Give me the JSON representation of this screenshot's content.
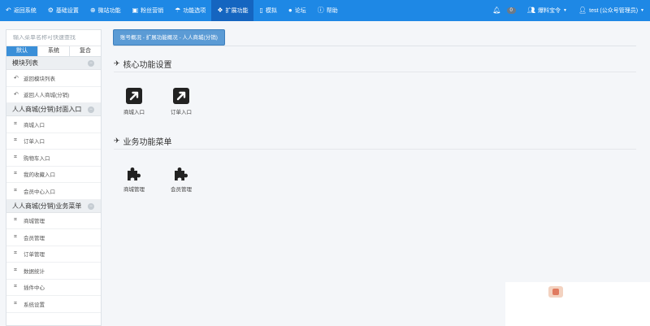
{
  "topnav": {
    "items": [
      {
        "label": "返回系统",
        "icon": "reply-icon"
      },
      {
        "label": "基础设置",
        "icon": "gear-icon"
      },
      {
        "label": "微站功能",
        "icon": "plus-circle-icon"
      },
      {
        "label": "粉丝营销",
        "icon": "gift-icon"
      },
      {
        "label": "功能选项",
        "icon": "umbrella-icon"
      },
      {
        "label": "扩展功能",
        "icon": "cubes-icon",
        "active": true
      },
      {
        "label": "模拟",
        "icon": "mobile-icon"
      },
      {
        "label": "论坛",
        "icon": "comment-icon"
      },
      {
        "label": "帮助",
        "icon": "info-circle-icon"
      }
    ],
    "notification_count": "0",
    "account_label": "爆料宝令",
    "user_label": "test (公众号管理员)"
  },
  "sidebar": {
    "search_placeholder": "输入菜单名称可快速查找",
    "tabs": [
      "默认",
      "系统",
      "复合"
    ],
    "groups": [
      {
        "title": "模块列表",
        "items": [
          "返回模块列表",
          "返回人人商城(分销)"
        ]
      },
      {
        "title": "人人商城(分销)封面入口",
        "items": [
          "商城入口",
          "订单入口",
          "购物车入口",
          "我的收藏入口",
          "会员中心入口"
        ]
      },
      {
        "title": "人人商城(分销)业务菜单",
        "items": [
          "商城管理",
          "会员管理",
          "订单管理",
          "数据统计",
          "插件中心",
          "系统设置"
        ]
      }
    ]
  },
  "main": {
    "breadcrumb": "账号概况 - 扩展功能概况 - 人人商城(分销)",
    "sections": [
      {
        "title": "核心功能设置",
        "tiles": [
          "商城入口",
          "订单入口"
        ]
      },
      {
        "title": "业务功能菜单",
        "tiles": [
          "商城管理",
          "会员管理"
        ]
      }
    ]
  },
  "colors": {
    "nav_bg": "#1e88e5",
    "nav_active": "#1565c0",
    "tab_active": "#3a8fd8",
    "breadcrumb_bg": "#5b9bd5"
  }
}
